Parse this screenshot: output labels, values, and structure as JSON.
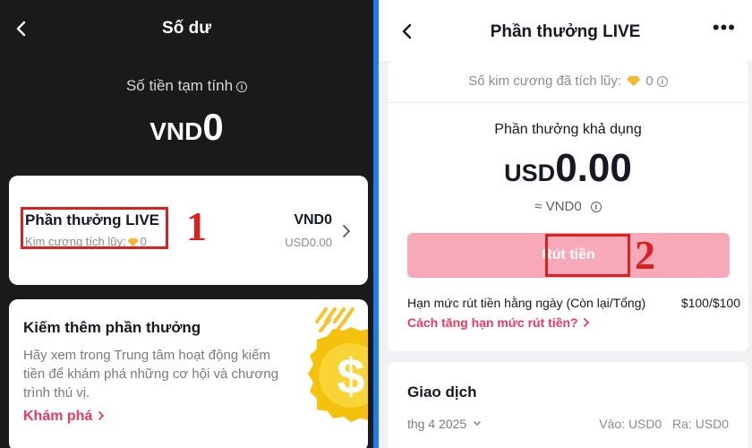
{
  "left": {
    "title": "Số dư",
    "tempo_label": "Số tiền tạm tính",
    "balance_currency": "VND",
    "balance_amount": "0",
    "live_card": {
      "title": "Phần thưởng LIVE",
      "sub_label": "Kim cương tích lũy:",
      "sub_value": "0",
      "vnd_value": "VND0",
      "usd_value": "USD0.00"
    },
    "annotation_1": "1",
    "earn_card": {
      "title": "Kiếm thêm phần thưởng",
      "description": "Hãy xem trong Trung tâm hoạt động kiếm tiền để khám phá những cơ hội và chương trình thú vị.",
      "explore_label": "Khám phá"
    }
  },
  "right": {
    "title": "Phần thưởng LIVE",
    "more_label": "•••",
    "accumulated_label": "Số kim cương đã tích lũy:",
    "accumulated_value": "0",
    "available_label": "Phần thưởng khả dụng",
    "usd_currency": "USD",
    "usd_amount": "0.00",
    "approx_vnd": "≈ VND0",
    "withdraw_label": "Rút tiền",
    "annotation_2": "2",
    "limit_label": "Hạn mức rút tiền hằng ngày (Còn lại/Tổng)",
    "limit_value": "$100/$100",
    "increase_link": "Cách tăng hạn mức rút tiền?",
    "transactions": {
      "title": "Giao dịch",
      "month": "thg 4 2025",
      "in_label": "Vào: USD0",
      "out_label": "Ra: USD0"
    }
  },
  "colors": {
    "accent_red": "#ea3a5a",
    "annotation_red": "#d9211f",
    "button_disabled": "#f8a9b9",
    "divider_blue": "#1d7cf2",
    "gem_gold": "#f5b82e"
  }
}
